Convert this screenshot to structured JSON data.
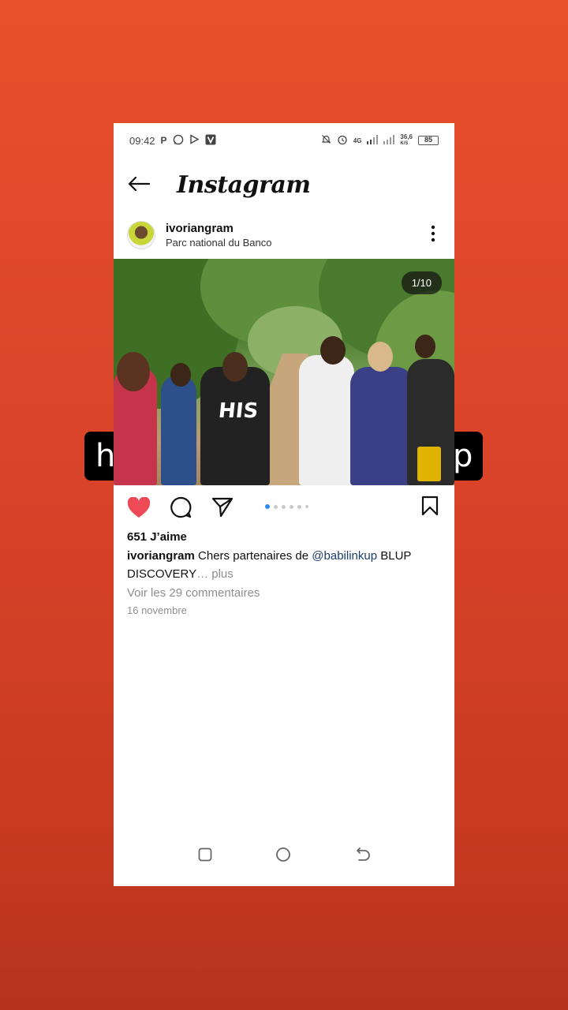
{
  "status_bar": {
    "time": "09:42",
    "left_icons": [
      "parking-icon",
      "whatsapp-icon",
      "play-icon",
      "v-icon"
    ],
    "network": "4G",
    "speed": "36,6",
    "speed_unit": "K/S",
    "battery": "85"
  },
  "app_bar": {
    "logo": "Instagram"
  },
  "post": {
    "username": "ivoriangram",
    "location": "Parc national du Banco",
    "photo_counter": "1/10",
    "shirt_text": "HIS",
    "likes": "651 J’aime",
    "caption_user": "ivoriangram",
    "caption_text": " Chers partenaires de ",
    "caption_mention": "@babilinkup",
    "caption_rest": " BLUP DISCOVERY",
    "caption_more": "… plus",
    "comments_link": "Voir les 29 commentaires",
    "date": "16 novembre",
    "carousel_pages": 6,
    "carousel_active": 1,
    "liked": true
  },
  "background": {
    "left_tab_text": "h",
    "right_tab_text": "p"
  }
}
